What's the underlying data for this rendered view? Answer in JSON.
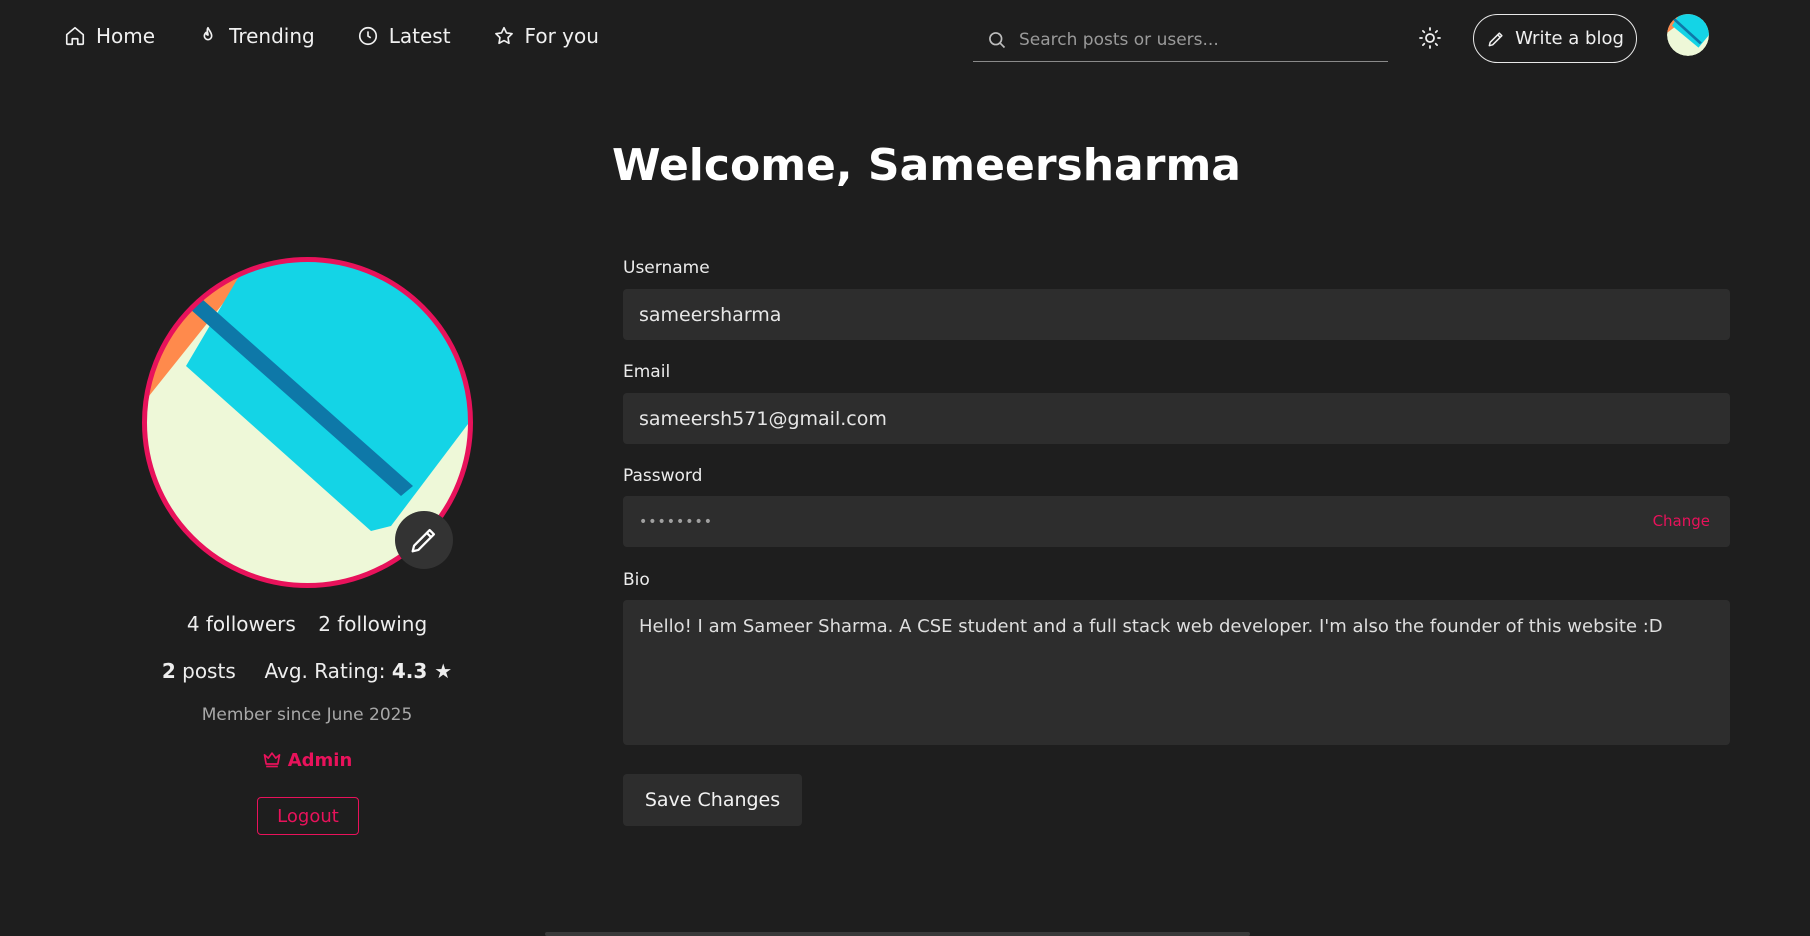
{
  "nav": {
    "items": [
      {
        "label": "Home",
        "icon": "home-icon"
      },
      {
        "label": "Trending",
        "icon": "flame-icon"
      },
      {
        "label": "Latest",
        "icon": "clock-icon"
      },
      {
        "label": "For you",
        "icon": "star-icon"
      }
    ],
    "search_placeholder": "Search posts or users...",
    "write_label": "Write a blog"
  },
  "profile": {
    "followers": "4 followers",
    "following": "2 following",
    "posts_count": "2",
    "posts_label": "posts",
    "rating_label": "Avg. Rating:",
    "rating_value": "4.3 ★",
    "member_since": "Member since June 2025",
    "role": "Admin",
    "logout_label": "Logout"
  },
  "form": {
    "welcome": "Welcome, Sameersharma",
    "username_label": "Username",
    "username_value": "sameersharma",
    "email_label": "Email",
    "email_value": "sameersh571@gmail.com",
    "password_label": "Password",
    "password_mask": "••••••••",
    "change_label": "Change",
    "bio_label": "Bio",
    "bio_value": "Hello! I am Sameer Sharma. A CSE student and a full stack web developer. I'm also the founder of this website :D",
    "save_label": "Save Changes"
  },
  "colors": {
    "accent": "#e8125b",
    "background": "#1e1e1e",
    "field": "#2d2d2d"
  }
}
